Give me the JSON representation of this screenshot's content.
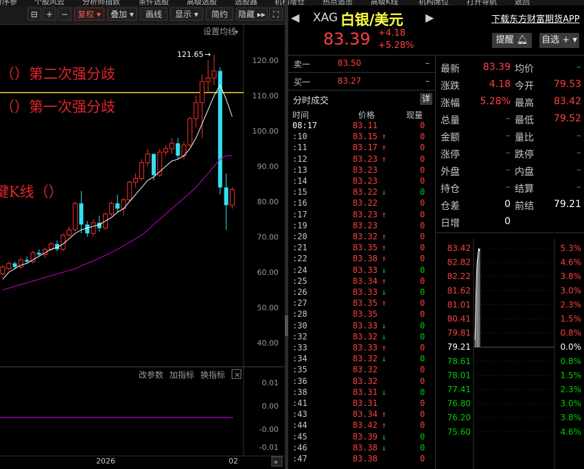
{
  "top_menu": [
    "行序参",
    "个股风云",
    "分析师指数",
    "条件选股",
    "高级选股",
    "选股器",
    "机构增仓",
    "热点追击",
    "高级K线",
    "机构席位",
    "打开导航",
    "返回"
  ],
  "toolbar": {
    "fuquan": "复权",
    "diejia": "叠加",
    "huaxian": "画线",
    "xianshi": "显示",
    "jianyue": "简约",
    "yincang": "隐藏"
  },
  "kline": {
    "setting_label": "设置均线",
    "peak_label": "121.65",
    "y_labels": [
      "120.00",
      "110.00",
      "100.00",
      "90.00",
      "80.00",
      "70.00",
      "60.00",
      "50.00",
      "40.00"
    ],
    "annotations": [
      "（）第二次强分歧",
      "（）第一次强分歧",
      "键K线（）"
    ],
    "sub_toolbar": [
      "改参数",
      "加指标",
      "换指标"
    ],
    "sub_y_labels": [
      "0.01",
      "0.00",
      "-0.00",
      "-0.01"
    ],
    "x_labels": [
      "2026",
      "02"
    ],
    "candles": [
      [
        59.5,
        62,
        59,
        61.5
      ],
      [
        61,
        63,
        60.5,
        62.5
      ],
      [
        62.5,
        63,
        61,
        61.5
      ],
      [
        61.5,
        64,
        61,
        63.5
      ],
      [
        63.5,
        64.5,
        62.5,
        63
      ],
      [
        63,
        66,
        62.5,
        65.5
      ],
      [
        65.5,
        66.5,
        64.5,
        65
      ],
      [
        65,
        67,
        64,
        66.5
      ],
      [
        66.5,
        68.5,
        66,
        68
      ],
      [
        68,
        69,
        66,
        66.5
      ],
      [
        66.5,
        71,
        66,
        70.5
      ],
      [
        70.5,
        73,
        70,
        72
      ],
      [
        72,
        80,
        71.5,
        79.5
      ],
      [
        79.5,
        83,
        71,
        73.5
      ],
      [
        73.5,
        74.5,
        70,
        71
      ],
      [
        71,
        75,
        70,
        74
      ],
      [
        74,
        76,
        71.5,
        72.5
      ],
      [
        72.5,
        77,
        72,
        76.5
      ],
      [
        76.5,
        80,
        76,
        79.5
      ],
      [
        79.5,
        82,
        77,
        78
      ],
      [
        78,
        81,
        76,
        80.5
      ],
      [
        80.5,
        86,
        80,
        85.5
      ],
      [
        85.5,
        88,
        84,
        86.5
      ],
      [
        86.5,
        92,
        86,
        91
      ],
      [
        91,
        95,
        90,
        93.5
      ],
      [
        93.5,
        92.5,
        86,
        87.5
      ],
      [
        87.5,
        95,
        87,
        94
      ],
      [
        94,
        96,
        93,
        95
      ],
      [
        95,
        98,
        93.5,
        96.5
      ],
      [
        96.5,
        98,
        92,
        93
      ],
      [
        93,
        97,
        92,
        96
      ],
      [
        96,
        104,
        95.5,
        103.5
      ],
      [
        103.5,
        110,
        101,
        108
      ],
      [
        108,
        116,
        98,
        114
      ],
      [
        114,
        120,
        111,
        115
      ],
      [
        115,
        121.65,
        113,
        117
      ],
      [
        117,
        118,
        82,
        84
      ],
      [
        84,
        88,
        72,
        79
      ],
      [
        79,
        84,
        78,
        83.4
      ]
    ],
    "ma_white": [
      58,
      60,
      61,
      62,
      62.5,
      63.5,
      64.5,
      65.5,
      66.5,
      67,
      68,
      69.5,
      71,
      72,
      72.5,
      73,
      73.5,
      74.5,
      75.5,
      77,
      78,
      80,
      82,
      84,
      86,
      87,
      88.5,
      90,
      91.5,
      92,
      93,
      95,
      98,
      102,
      106,
      110,
      113,
      109,
      104
    ],
    "ma_magenta": [
      55,
      55.5,
      56,
      56.5,
      57,
      57.5,
      58,
      58.5,
      59,
      59.5,
      60,
      60.5,
      61,
      61.8,
      62.5,
      63.2,
      64,
      64.8,
      65.6,
      66.5,
      67.5,
      68.5,
      69.5,
      70.5,
      72,
      73.5,
      75,
      76.5,
      78,
      79.5,
      81,
      82.5,
      84,
      86,
      88,
      90,
      92,
      93,
      93
    ]
  },
  "quote": {
    "symbol": "XAG",
    "name": "白银/美元",
    "price": "83.39",
    "change": "+4.18",
    "change_pct": "+5.28%",
    "download_link": "下载东方财富期货APP",
    "alert_button": "提醒",
    "watchlist_button": "自选",
    "sell1_label": "卖一",
    "sell1_price": "83.50",
    "sell1_vol": "–",
    "buy1_label": "买一",
    "buy1_price": "83.27",
    "buy1_vol": "–",
    "trades_title": "分时成交",
    "trades_detail": "详",
    "trade_headers": [
      "时间",
      "价格",
      "现量"
    ],
    "trades": [
      {
        "t": "08:17",
        "p": "83.11",
        "a": "",
        "v": "0"
      },
      {
        "t": ":10",
        "p": "83.15",
        "a": "↑",
        "v": "0"
      },
      {
        "t": ":11",
        "p": "83.17",
        "a": "↑",
        "v": "0"
      },
      {
        "t": ":12",
        "p": "83.23",
        "a": "↑",
        "v": "0"
      },
      {
        "t": ":13",
        "p": "83.23",
        "a": "",
        "v": "0"
      },
      {
        "t": ":14",
        "p": "83.23",
        "a": "",
        "v": "0"
      },
      {
        "t": ":15",
        "p": "83.22",
        "a": "↓",
        "v": "0"
      },
      {
        "t": ":16",
        "p": "83.22",
        "a": "",
        "v": "0"
      },
      {
        "t": ":17",
        "p": "83.23",
        "a": "↑",
        "v": "0"
      },
      {
        "t": ":19",
        "p": "83.23",
        "a": "",
        "v": "0"
      },
      {
        "t": ":20",
        "p": "83.32",
        "a": "↑",
        "v": "0"
      },
      {
        "t": ":21",
        "p": "83.35",
        "a": "↑",
        "v": "0"
      },
      {
        "t": ":22",
        "p": "83.38",
        "a": "↑",
        "v": "0"
      },
      {
        "t": ":24",
        "p": "83.33",
        "a": "↓",
        "v": "0"
      },
      {
        "t": ":25",
        "p": "83.34",
        "a": "↑",
        "v": "0"
      },
      {
        "t": ":26",
        "p": "83.33",
        "a": "↓",
        "v": "0"
      },
      {
        "t": ":27",
        "p": "83.35",
        "a": "↑",
        "v": "0"
      },
      {
        "t": ":28",
        "p": "83.35",
        "a": "",
        "v": "0"
      },
      {
        "t": ":30",
        "p": "83.33",
        "a": "↓",
        "v": "0"
      },
      {
        "t": ":32",
        "p": "83.32",
        "a": "↓",
        "v": "0"
      },
      {
        "t": ":33",
        "p": "83.33",
        "a": "↑",
        "v": "0"
      },
      {
        "t": ":34",
        "p": "83.32",
        "a": "↓",
        "v": "0"
      },
      {
        "t": ":35",
        "p": "83.32",
        "a": "",
        "v": "0"
      },
      {
        "t": ":36",
        "p": "83.32",
        "a": "",
        "v": "0"
      },
      {
        "t": ":38",
        "p": "83.31",
        "a": "↓",
        "v": "0"
      },
      {
        "t": ":41",
        "p": "83.31",
        "a": "",
        "v": "0"
      },
      {
        "t": ":43",
        "p": "83.34",
        "a": "↑",
        "v": "0"
      },
      {
        "t": ":44",
        "p": "83.42",
        "a": "↑",
        "v": "0"
      },
      {
        "t": ":45",
        "p": "83.39",
        "a": "↓",
        "v": "0"
      },
      {
        "t": ":46",
        "p": "83.38",
        "a": "↓",
        "v": "0"
      },
      {
        "t": ":47",
        "p": "83.38",
        "a": "",
        "v": "0"
      }
    ],
    "stats": [
      {
        "l1": "最新",
        "v1": "83.39",
        "c1": "red",
        "l2": "均价",
        "v2": "–",
        "c2": "green"
      },
      {
        "l1": "涨跌",
        "v1": "4.18",
        "c1": "red",
        "l2": "今开",
        "v2": "79.53",
        "c2": "red"
      },
      {
        "l1": "涨幅",
        "v1": "5.28%",
        "c1": "red",
        "l2": "最高",
        "v2": "83.42",
        "c2": "red"
      },
      {
        "l1": "总量",
        "v1": "–",
        "c1": "green",
        "l2": "最低",
        "v2": "79.52",
        "c2": "red"
      },
      {
        "l1": "金额",
        "v1": "–",
        "c1": "green",
        "l2": "量比",
        "v2": "–",
        "c2": "green"
      },
      {
        "l1": "涨停",
        "v1": "–",
        "c1": "red",
        "l2": "跌停",
        "v2": "–",
        "c2": "green"
      },
      {
        "l1": "外盘",
        "v1": "–",
        "c1": "red",
        "l2": "内盘",
        "v2": "–",
        "c2": "green"
      },
      {
        "l1": "持仓",
        "v1": "–",
        "c1": "green",
        "l2": "结算",
        "v2": "–",
        "c2": "green"
      },
      {
        "l1": "仓差",
        "v1": "0",
        "c1": "white",
        "l2": "前结",
        "v2": "79.21",
        "c2": "white"
      },
      {
        "l1": "日增",
        "v1": "0",
        "c1": "white",
        "l2": "",
        "v2": "",
        "c2": "white"
      }
    ],
    "intraday": {
      "left_labels": [
        "83.42",
        "82.82",
        "82.22",
        "81.62",
        "81.01",
        "80.41",
        "79.81",
        "79.21",
        "78.61",
        "78.01",
        "77.41",
        "76.80",
        "76.20",
        "75.60"
      ],
      "right_labels": [
        "5.3%",
        "4.6%",
        "3.8%",
        "3.0%",
        "2.3%",
        "1.5%",
        "0.8%",
        "0.0%",
        "0.8%",
        "1.5%",
        "2.3%",
        "3.0%",
        "3.8%",
        "4.6%"
      ],
      "series": [
        79.53,
        80.2,
        81.5,
        82.3,
        82.8,
        83.0,
        83.2,
        83.42,
        83.3,
        83.39
      ]
    }
  },
  "colors": {
    "up": "#ff4040",
    "down": "#00ffff",
    "cyan": "#33e0f0",
    "gold": "#ffff44",
    "magenta": "#d000d0"
  }
}
